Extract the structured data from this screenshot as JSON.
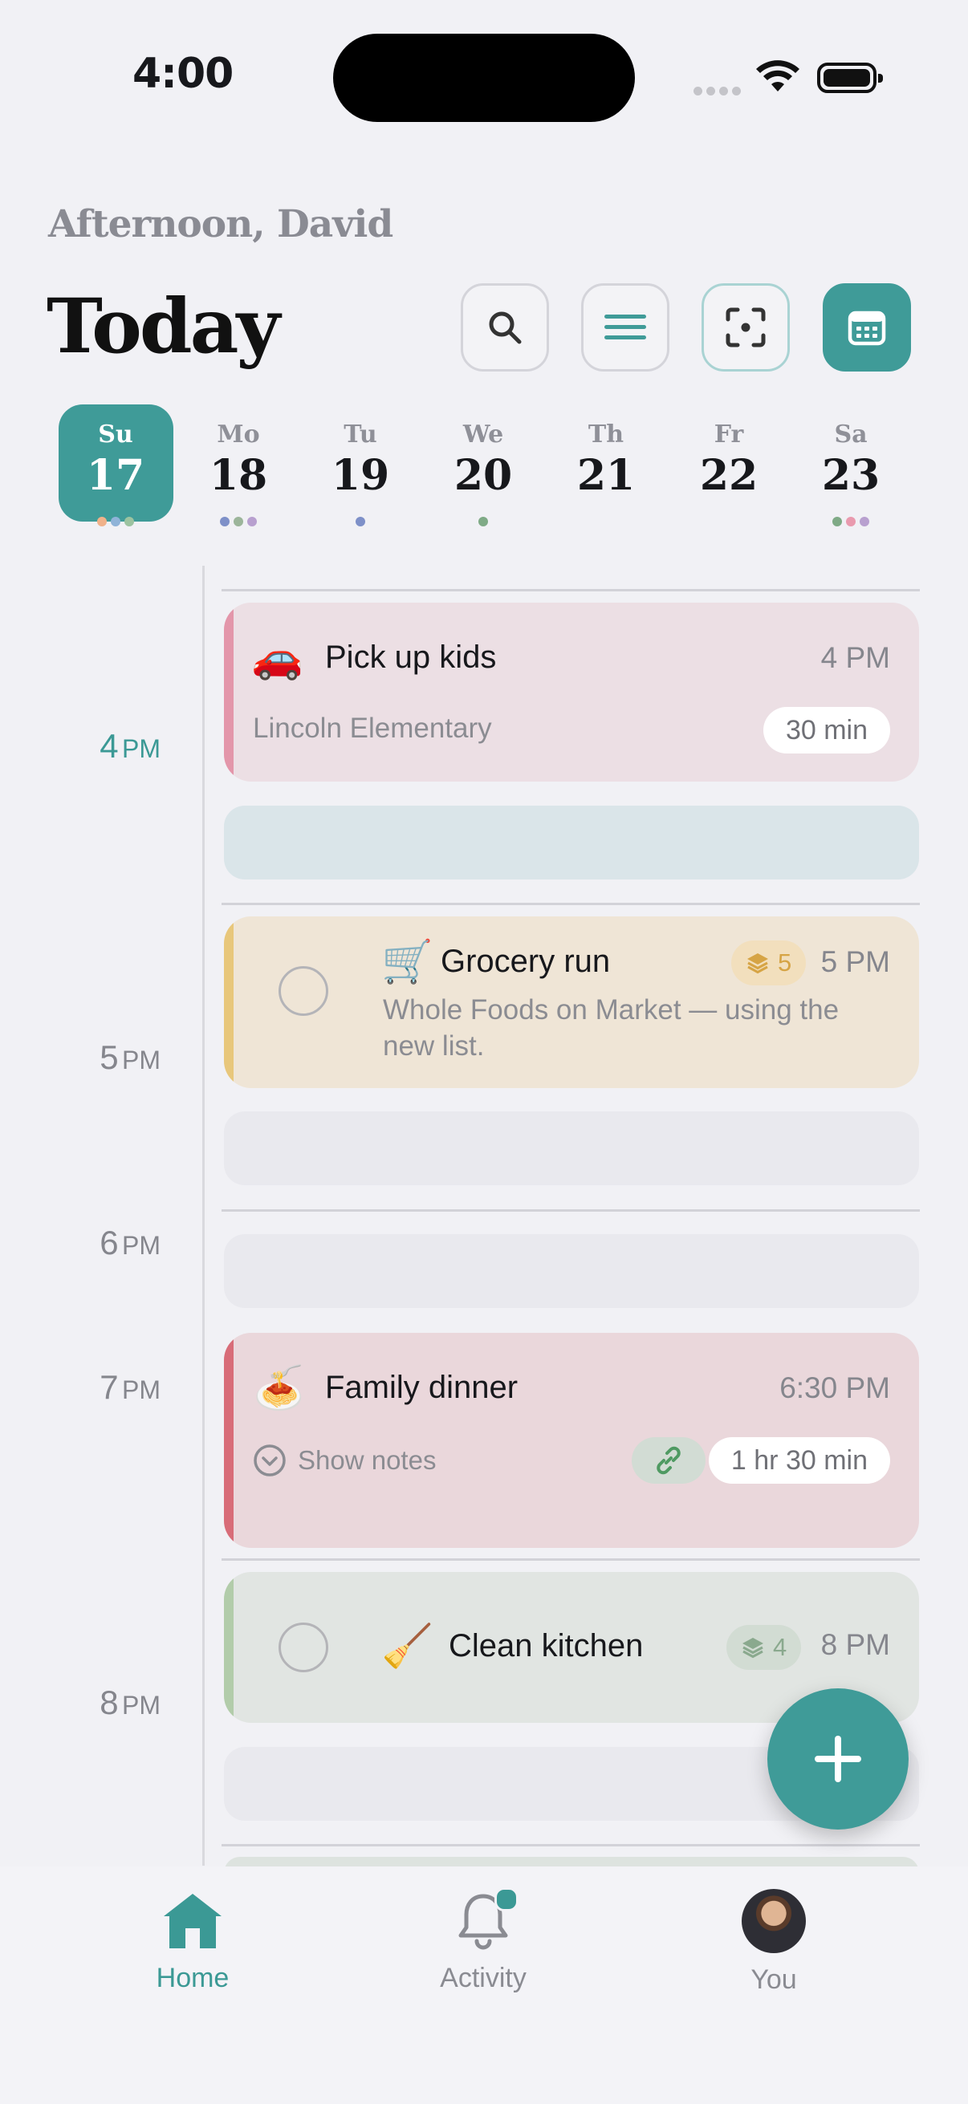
{
  "status_bar": {
    "time": "4:00"
  },
  "header": {
    "greeting": "Afternoon, David",
    "title": "Today",
    "icons": [
      "search-icon",
      "menu-icon",
      "scan-icon",
      "calendar-icon"
    ]
  },
  "week": [
    {
      "name": "Su",
      "date": "17",
      "selected": true,
      "dots": [
        "#f0b28a",
        "#8fb3d8",
        "#9cc3a0"
      ]
    },
    {
      "name": "Mo",
      "date": "18",
      "dots": [
        "#7e90c8",
        "#9cb59a",
        "#b8a0cf"
      ]
    },
    {
      "name": "Tu",
      "date": "19",
      "dots": [
        "#7e90c8"
      ]
    },
    {
      "name": "We",
      "date": "20",
      "dots": [
        "#7faa86"
      ]
    },
    {
      "name": "Th",
      "date": "21",
      "dots": []
    },
    {
      "name": "Fr",
      "date": "22",
      "dots": []
    },
    {
      "name": "Sa",
      "date": "23",
      "dots": [
        "#7faa86",
        "#e99aae",
        "#b8a0cf"
      ]
    }
  ],
  "hours": [
    {
      "n": "4",
      "u": "PM"
    },
    {
      "n": "5",
      "u": "PM"
    },
    {
      "n": "6",
      "u": "PM"
    },
    {
      "n": "7",
      "u": "PM"
    },
    {
      "n": "8",
      "u": "PM"
    }
  ],
  "events": {
    "pickup": {
      "emoji": "🚗",
      "title": "Pick up kids",
      "time": "4 PM",
      "location": "Lincoln Elementary",
      "duration": "30 min"
    },
    "grocery": {
      "emoji": "🛒",
      "title": "Grocery run",
      "badge": "5",
      "time": "5 PM",
      "description": "Whole Foods on Market — using the new list."
    },
    "dinner": {
      "emoji": "🍝",
      "title": "Family dinner",
      "time": "6:30 PM",
      "notes_label": "Show notes",
      "duration": "1 hr 30 min"
    },
    "kitchen": {
      "emoji": "🧹",
      "title": "Clean kitchen",
      "badge": "4",
      "time": "8 PM"
    }
  },
  "colors": {
    "accent": "#3f9b98",
    "pickup_bg": "#ecdfe4",
    "pickup_bar": "#e396aa",
    "grocery_bg": "#efe5d6",
    "grocery_bar": "#e8c77b",
    "dinner_bg": "#ead7db",
    "dinner_bar": "#d86c78",
    "kitchen_bg": "#e1e5e2",
    "kitchen_bar": "#b2ccaa"
  },
  "tabs": [
    {
      "label": "Home",
      "icon": "home-icon",
      "active": true
    },
    {
      "label": "Activity",
      "icon": "bell-icon",
      "notification": true
    },
    {
      "label": "You",
      "icon": "avatar"
    }
  ]
}
